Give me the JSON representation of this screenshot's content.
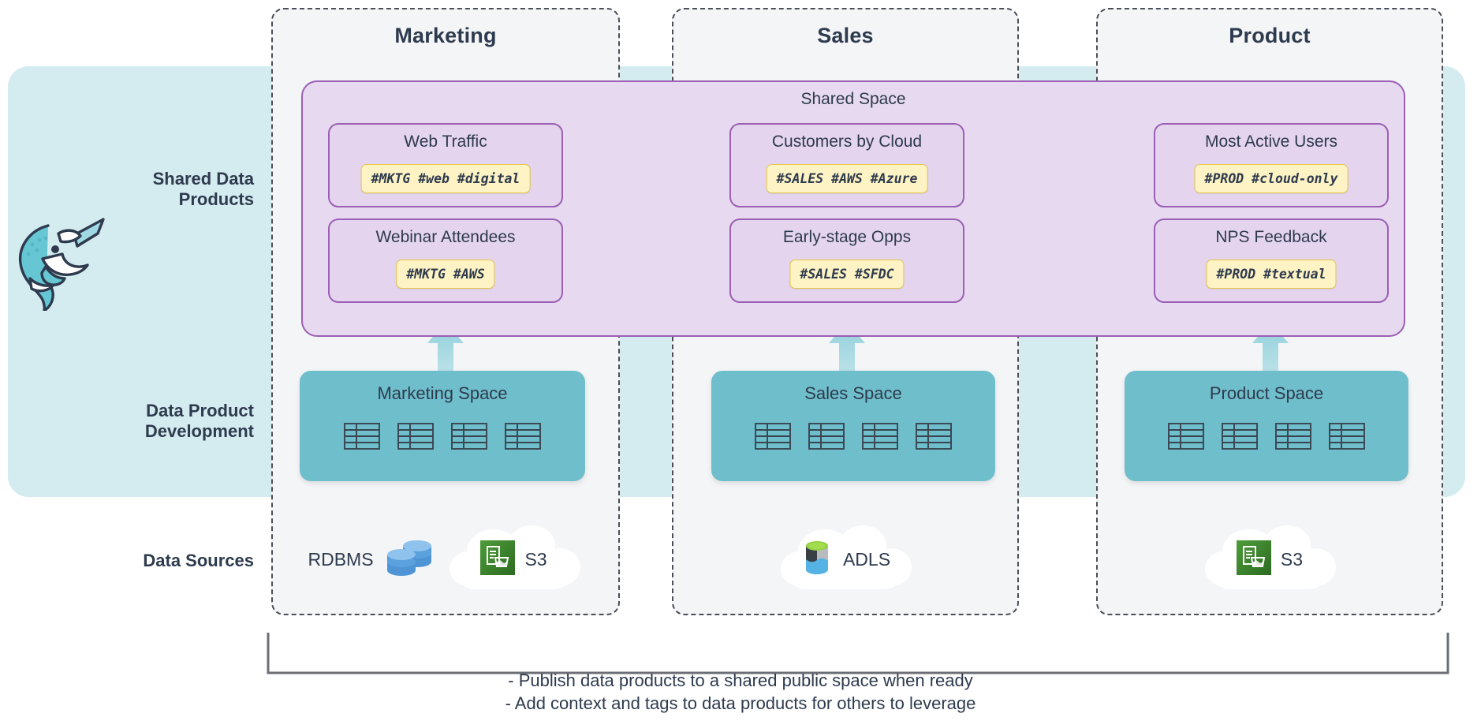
{
  "rows": {
    "shared_data_products": "Shared Data\nProducts",
    "shared_data_products_l1": "Shared Data",
    "shared_data_products_l2": "Products",
    "data_product_development_l1": "Data Product",
    "data_product_development_l2": "Development",
    "data_sources": "Data Sources"
  },
  "shared_space": {
    "label": "Shared Space"
  },
  "columns": [
    {
      "id": "marketing",
      "title": "Marketing",
      "space_name": "Marketing Space",
      "table_count": 4,
      "products": [
        {
          "name": "Web Traffic",
          "tags": "#MKTG #web #digital"
        },
        {
          "name": "Webinar Attendees",
          "tags": "#MKTG #AWS"
        }
      ],
      "sources": [
        {
          "name": "RDBMS",
          "icon": "database-stack-icon",
          "cloud": false
        },
        {
          "name": "S3",
          "icon": "aws-s3-icon",
          "cloud": true
        }
      ]
    },
    {
      "id": "sales",
      "title": "Sales",
      "space_name": "Sales Space",
      "table_count": 4,
      "products": [
        {
          "name": "Customers by Cloud",
          "tags": "#SALES #AWS #Azure"
        },
        {
          "name": "Early-stage Opps",
          "tags": "#SALES #SFDC"
        }
      ],
      "sources": [
        {
          "name": "ADLS",
          "icon": "azure-adls-icon",
          "cloud": true
        }
      ]
    },
    {
      "id": "product",
      "title": "Product",
      "space_name": "Product Space",
      "table_count": 4,
      "products": [
        {
          "name": "Most Active Users",
          "tags": "#PROD #cloud-only"
        },
        {
          "name": "NPS Feedback",
          "tags": "#PROD #textual"
        }
      ],
      "sources": [
        {
          "name": "S3",
          "icon": "aws-s3-icon",
          "cloud": true
        }
      ]
    }
  ],
  "notes": {
    "line1": "- Publish data products to a shared public space when ready",
    "line2": "- Add context and tags to data products for others to leverage"
  },
  "colors": {
    "band_teal": "#d4ecf0",
    "space_teal": "#6fbecb",
    "shared_purple_bg": "#e7d9ef",
    "shared_purple_border": "#9b5fb5",
    "card_purple_bg": "#e4d4ee",
    "tag_yellow_bg": "#fdf3c4",
    "tag_yellow_border": "#e7c649",
    "text_dark": "#2e3a4d",
    "dashed_border": "#4a4f57",
    "column_bg": "#f4f5f7"
  }
}
